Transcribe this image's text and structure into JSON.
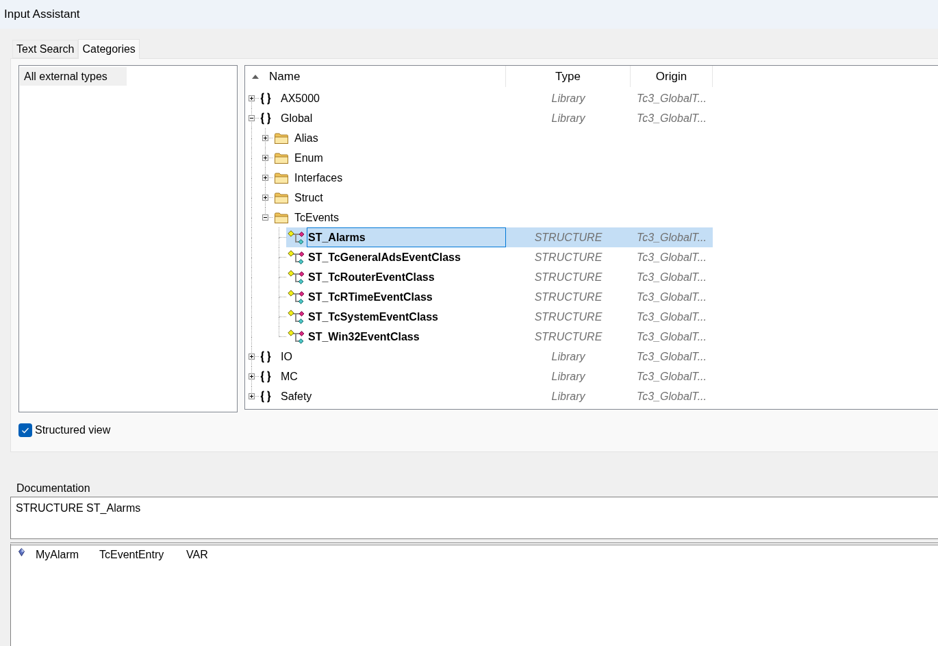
{
  "window": {
    "title": "Input Assistant"
  },
  "tabs": [
    {
      "label": "Text Search",
      "selected": false
    },
    {
      "label": "Categories",
      "selected": true
    }
  ],
  "categories": [
    {
      "label": "All external types",
      "selected": true
    }
  ],
  "tree": {
    "columns": [
      {
        "label": "Name",
        "sorted_ascending": true
      },
      {
        "label": "Type"
      },
      {
        "label": "Origin"
      }
    ],
    "nodes": [
      {
        "kind": "library",
        "name": "AX5000",
        "type": "Library",
        "origin": "Tc3_GlobalT...",
        "expanded": false,
        "selected": false
      },
      {
        "kind": "library",
        "name": "Global",
        "type": "Library",
        "origin": "Tc3_GlobalT...",
        "expanded": true,
        "selected": false,
        "children": [
          {
            "kind": "folder",
            "name": "Alias",
            "expanded": false,
            "selected": false
          },
          {
            "kind": "folder",
            "name": "Enum",
            "expanded": false,
            "selected": false
          },
          {
            "kind": "folder",
            "name": "Interfaces",
            "expanded": false,
            "selected": false
          },
          {
            "kind": "folder",
            "name": "Struct",
            "expanded": false,
            "selected": false
          },
          {
            "kind": "folder",
            "name": "TcEvents",
            "expanded": true,
            "selected": false,
            "children": [
              {
                "kind": "structure",
                "name": "ST_Alarms",
                "type": "STRUCTURE",
                "origin": "Tc3_GlobalT...",
                "selected": true
              },
              {
                "kind": "structure",
                "name": "ST_TcGeneralAdsEventClass",
                "type": "STRUCTURE",
                "origin": "Tc3_GlobalT...",
                "selected": false
              },
              {
                "kind": "structure",
                "name": "ST_TcRouterEventClass",
                "type": "STRUCTURE",
                "origin": "Tc3_GlobalT...",
                "selected": false
              },
              {
                "kind": "structure",
                "name": "ST_TcRTimeEventClass",
                "type": "STRUCTURE",
                "origin": "Tc3_GlobalT...",
                "selected": false
              },
              {
                "kind": "structure",
                "name": "ST_TcSystemEventClass",
                "type": "STRUCTURE",
                "origin": "Tc3_GlobalT...",
                "selected": false
              },
              {
                "kind": "structure",
                "name": "ST_Win32EventClass",
                "type": "STRUCTURE",
                "origin": "Tc3_GlobalT...",
                "selected": false
              }
            ]
          }
        ]
      },
      {
        "kind": "library",
        "name": "IO",
        "type": "Library",
        "origin": "Tc3_GlobalT...",
        "expanded": false,
        "selected": false
      },
      {
        "kind": "library",
        "name": "MC",
        "type": "Library",
        "origin": "Tc3_GlobalT...",
        "expanded": false,
        "selected": false
      },
      {
        "kind": "library",
        "name": "Safety",
        "type": "Library",
        "origin": "Tc3_GlobalT...",
        "expanded": false,
        "selected": false
      }
    ]
  },
  "structured_view": {
    "label": "Structured view",
    "checked": true
  },
  "documentation": {
    "label": "Documentation",
    "text": "STRUCTURE ST_Alarms",
    "members": [
      {
        "name": "MyAlarm",
        "type": "TcEventEntry",
        "scope": "VAR"
      }
    ]
  }
}
